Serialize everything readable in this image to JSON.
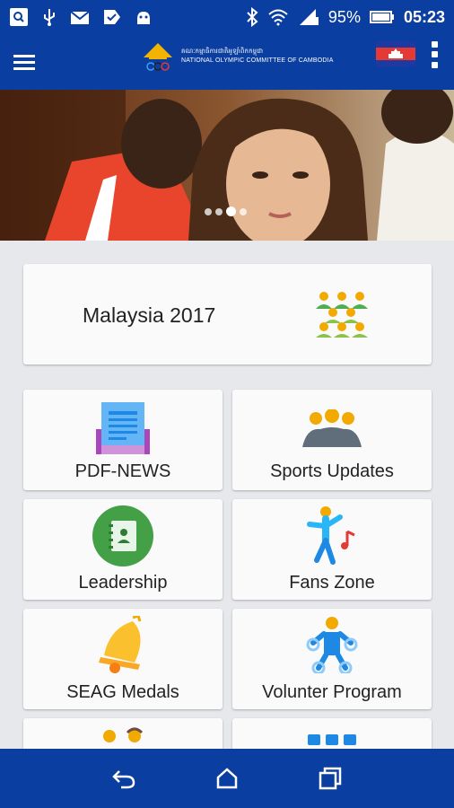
{
  "status_bar": {
    "battery": "95%",
    "time": "05:23",
    "icons": [
      "screen-capture-icon",
      "usb-icon",
      "mail-icon",
      "check-icon",
      "android-icon",
      "bluetooth-icon",
      "wifi-icon",
      "signal-icon",
      "battery-icon"
    ]
  },
  "app_bar": {
    "logo_line1": "គណៈកម្មាធិការជាតិអូឡាំពិកកម្ពុជា",
    "logo_line2": "NATIONAL OLYMPIC COMMITTEE OF CAMBODIA",
    "menu_icon": "hamburger-icon",
    "flag_icon": "cambodia-flag-icon",
    "more_icon": "more-vert-icon"
  },
  "banner": {
    "slides": 4,
    "active_slide": 3
  },
  "featured": {
    "label": "Malaysia 2017",
    "icon": "group-people-icon"
  },
  "tiles": [
    {
      "label": "PDF-NEWS",
      "icon": "newspaper-icon"
    },
    {
      "label": "Sports Updates",
      "icon": "team-icon"
    },
    {
      "label": "Leadership",
      "icon": "contacts-book-icon"
    },
    {
      "label": "Fans Zone",
      "icon": "dancing-person-icon"
    },
    {
      "label": "SEAG Medals",
      "icon": "bell-icon"
    },
    {
      "label": "Volunter Program",
      "icon": "volunteer-icon"
    },
    {
      "label": "",
      "icon": "kids-icon"
    },
    {
      "label": "",
      "icon": "grid-icon"
    }
  ],
  "nav_bar": {
    "icons": [
      "back-icon",
      "home-icon",
      "recents-icon"
    ]
  },
  "colors": {
    "primary": "#0a3ea0",
    "background": "#e6e8ec",
    "card": "#fafafa"
  }
}
